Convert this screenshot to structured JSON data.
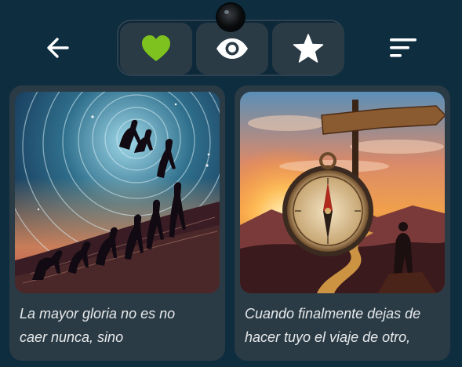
{
  "toolbar": {
    "back_icon": "arrow-left-icon",
    "sort_icon": "sort-lines-icon",
    "tabs": [
      {
        "icon": "heart-icon",
        "color": "#7dc21e",
        "selected": true
      },
      {
        "icon": "eye-icon",
        "color": "#ffffff",
        "selected": false
      },
      {
        "icon": "star-icon",
        "color": "#ffffff",
        "selected": false
      }
    ]
  },
  "cards": [
    {
      "image": "silhouettes-climbing-spiral-illustration",
      "caption": "La mayor gloria no es no\ncaer nunca, sino"
    },
    {
      "image": "compass-and-signpost-sunset-illustration",
      "caption": "Cuando finalmente dejas de\nhacer tuyo el viaje de otro,"
    }
  ],
  "colors": {
    "background": "#0e2d3f",
    "card": "#2b3b45",
    "accent": "#7dc21e"
  }
}
